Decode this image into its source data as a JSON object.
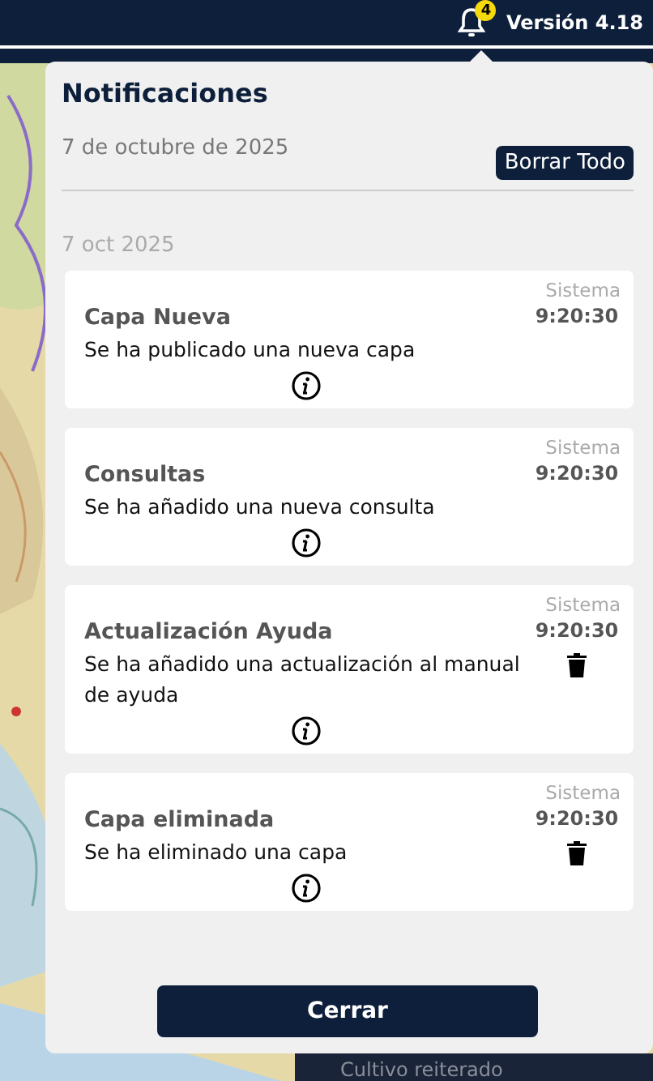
{
  "header": {
    "badge": "4",
    "version": "Versión 4.18"
  },
  "panel": {
    "title": "Notificaciones",
    "date": "7 de octubre de 2025",
    "clear_button": "Borrar Todo",
    "group_date": "7 oct 2025",
    "notifications": [
      {
        "title": "Capa Nueva",
        "message": "Se ha publicado una nueva capa",
        "source": "Sistema",
        "time": "9:20:30",
        "deletable": false
      },
      {
        "title": "Consultas",
        "message": "Se ha añadido una nueva consulta",
        "source": "Sistema",
        "time": "9:20:30",
        "deletable": false
      },
      {
        "title": "Actualización Ayuda",
        "message": "Se ha añadido una actualización al manual de ayuda",
        "source": "Sistema",
        "time": "9:20:30",
        "deletable": true
      },
      {
        "title": "Capa eliminada",
        "message": "Se ha eliminado una capa",
        "source": "Sistema",
        "time": "9:20:30",
        "deletable": true
      }
    ],
    "close_button": "Cerrar"
  },
  "legend": {
    "label": "Cultivo reiterado"
  }
}
